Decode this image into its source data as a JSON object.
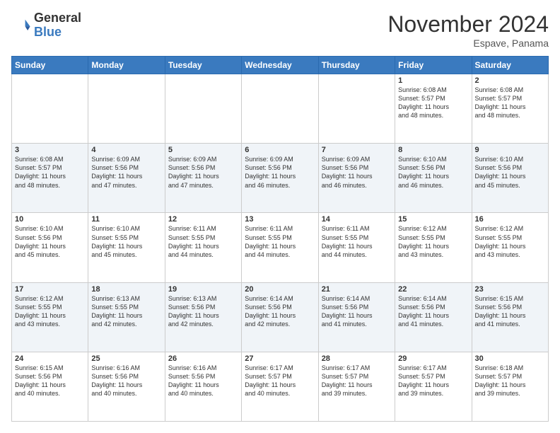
{
  "header": {
    "logo_general": "General",
    "logo_blue": "Blue",
    "month_title": "November 2024",
    "location": "Espave, Panama"
  },
  "weekdays": [
    "Sunday",
    "Monday",
    "Tuesday",
    "Wednesday",
    "Thursday",
    "Friday",
    "Saturday"
  ],
  "weeks": [
    [
      {
        "day": "",
        "info": ""
      },
      {
        "day": "",
        "info": ""
      },
      {
        "day": "",
        "info": ""
      },
      {
        "day": "",
        "info": ""
      },
      {
        "day": "",
        "info": ""
      },
      {
        "day": "1",
        "info": "Sunrise: 6:08 AM\nSunset: 5:57 PM\nDaylight: 11 hours\nand 48 minutes."
      },
      {
        "day": "2",
        "info": "Sunrise: 6:08 AM\nSunset: 5:57 PM\nDaylight: 11 hours\nand 48 minutes."
      }
    ],
    [
      {
        "day": "3",
        "info": "Sunrise: 6:08 AM\nSunset: 5:57 PM\nDaylight: 11 hours\nand 48 minutes."
      },
      {
        "day": "4",
        "info": "Sunrise: 6:09 AM\nSunset: 5:56 PM\nDaylight: 11 hours\nand 47 minutes."
      },
      {
        "day": "5",
        "info": "Sunrise: 6:09 AM\nSunset: 5:56 PM\nDaylight: 11 hours\nand 47 minutes."
      },
      {
        "day": "6",
        "info": "Sunrise: 6:09 AM\nSunset: 5:56 PM\nDaylight: 11 hours\nand 46 minutes."
      },
      {
        "day": "7",
        "info": "Sunrise: 6:09 AM\nSunset: 5:56 PM\nDaylight: 11 hours\nand 46 minutes."
      },
      {
        "day": "8",
        "info": "Sunrise: 6:10 AM\nSunset: 5:56 PM\nDaylight: 11 hours\nand 46 minutes."
      },
      {
        "day": "9",
        "info": "Sunrise: 6:10 AM\nSunset: 5:56 PM\nDaylight: 11 hours\nand 45 minutes."
      }
    ],
    [
      {
        "day": "10",
        "info": "Sunrise: 6:10 AM\nSunset: 5:56 PM\nDaylight: 11 hours\nand 45 minutes."
      },
      {
        "day": "11",
        "info": "Sunrise: 6:10 AM\nSunset: 5:55 PM\nDaylight: 11 hours\nand 45 minutes."
      },
      {
        "day": "12",
        "info": "Sunrise: 6:11 AM\nSunset: 5:55 PM\nDaylight: 11 hours\nand 44 minutes."
      },
      {
        "day": "13",
        "info": "Sunrise: 6:11 AM\nSunset: 5:55 PM\nDaylight: 11 hours\nand 44 minutes."
      },
      {
        "day": "14",
        "info": "Sunrise: 6:11 AM\nSunset: 5:55 PM\nDaylight: 11 hours\nand 44 minutes."
      },
      {
        "day": "15",
        "info": "Sunrise: 6:12 AM\nSunset: 5:55 PM\nDaylight: 11 hours\nand 43 minutes."
      },
      {
        "day": "16",
        "info": "Sunrise: 6:12 AM\nSunset: 5:55 PM\nDaylight: 11 hours\nand 43 minutes."
      }
    ],
    [
      {
        "day": "17",
        "info": "Sunrise: 6:12 AM\nSunset: 5:55 PM\nDaylight: 11 hours\nand 43 minutes."
      },
      {
        "day": "18",
        "info": "Sunrise: 6:13 AM\nSunset: 5:55 PM\nDaylight: 11 hours\nand 42 minutes."
      },
      {
        "day": "19",
        "info": "Sunrise: 6:13 AM\nSunset: 5:56 PM\nDaylight: 11 hours\nand 42 minutes."
      },
      {
        "day": "20",
        "info": "Sunrise: 6:14 AM\nSunset: 5:56 PM\nDaylight: 11 hours\nand 42 minutes."
      },
      {
        "day": "21",
        "info": "Sunrise: 6:14 AM\nSunset: 5:56 PM\nDaylight: 11 hours\nand 41 minutes."
      },
      {
        "day": "22",
        "info": "Sunrise: 6:14 AM\nSunset: 5:56 PM\nDaylight: 11 hours\nand 41 minutes."
      },
      {
        "day": "23",
        "info": "Sunrise: 6:15 AM\nSunset: 5:56 PM\nDaylight: 11 hours\nand 41 minutes."
      }
    ],
    [
      {
        "day": "24",
        "info": "Sunrise: 6:15 AM\nSunset: 5:56 PM\nDaylight: 11 hours\nand 40 minutes."
      },
      {
        "day": "25",
        "info": "Sunrise: 6:16 AM\nSunset: 5:56 PM\nDaylight: 11 hours\nand 40 minutes."
      },
      {
        "day": "26",
        "info": "Sunrise: 6:16 AM\nSunset: 5:56 PM\nDaylight: 11 hours\nand 40 minutes."
      },
      {
        "day": "27",
        "info": "Sunrise: 6:17 AM\nSunset: 5:57 PM\nDaylight: 11 hours\nand 40 minutes."
      },
      {
        "day": "28",
        "info": "Sunrise: 6:17 AM\nSunset: 5:57 PM\nDaylight: 11 hours\nand 39 minutes."
      },
      {
        "day": "29",
        "info": "Sunrise: 6:17 AM\nSunset: 5:57 PM\nDaylight: 11 hours\nand 39 minutes."
      },
      {
        "day": "30",
        "info": "Sunrise: 6:18 AM\nSunset: 5:57 PM\nDaylight: 11 hours\nand 39 minutes."
      }
    ]
  ]
}
